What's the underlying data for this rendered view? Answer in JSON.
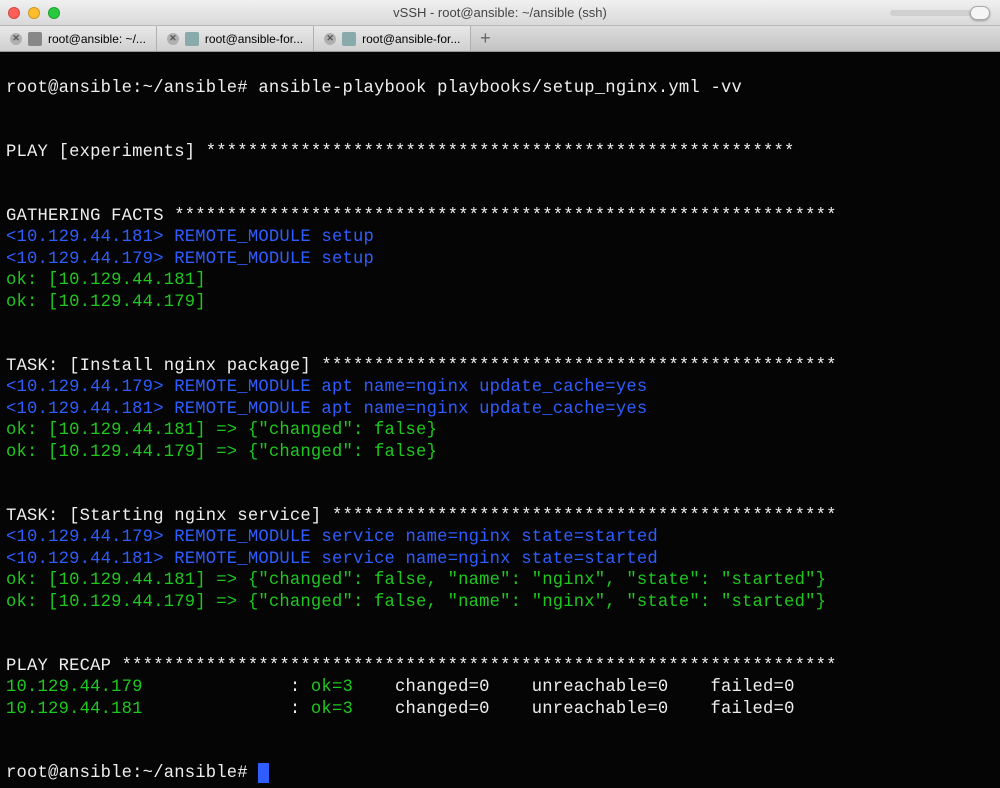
{
  "window": {
    "title": "vSSH - root@ansible: ~/ansible (ssh)"
  },
  "tabs": [
    {
      "label": "root@ansible: ~/...",
      "favicon_color": "grey"
    },
    {
      "label": "root@ansible-for...",
      "favicon_color": "greyblue"
    },
    {
      "label": "root@ansible-for...",
      "favicon_color": "greyblue"
    }
  ],
  "prompt1": "root@ansible:~/ansible# ",
  "command": "ansible-playbook playbooks/setup_nginx.yml -vv",
  "play_header": "PLAY [experiments] ******************************************************** ",
  "gather_header": "GATHERING FACTS *************************************************************** ",
  "remote_setup1": "<10.129.44.181> REMOTE_MODULE setup",
  "remote_setup2": "<10.129.44.179> REMOTE_MODULE setup",
  "ok_181": "ok: [10.129.44.181]",
  "ok_179": "ok: [10.129.44.179]",
  "task1_header": "TASK: [Install nginx package] ************************************************* ",
  "task1_remote1": "<10.129.44.179> REMOTE_MODULE apt name=nginx update_cache=yes",
  "task1_remote2": "<10.129.44.181> REMOTE_MODULE apt name=nginx update_cache=yes",
  "task1_ok1": "ok: [10.129.44.181] => {\"changed\": false}",
  "task1_ok2": "ok: [10.129.44.179] => {\"changed\": false}",
  "task2_header": "TASK: [Starting nginx service] ************************************************ ",
  "task2_remote1": "<10.129.44.179> REMOTE_MODULE service name=nginx state=started",
  "task2_remote2": "<10.129.44.181> REMOTE_MODULE service name=nginx state=started",
  "task2_ok1": "ok: [10.129.44.181] => {\"changed\": false, \"name\": \"nginx\", \"state\": \"started\"}",
  "task2_ok2": "ok: [10.129.44.179] => {\"changed\": false, \"name\": \"nginx\", \"state\": \"started\"}",
  "recap_header": "PLAY RECAP ******************************************************************** ",
  "recap1_host": "10.129.44.179              ",
  "recap1_colon": ": ",
  "recap1_ok": "ok=3   ",
  "recap1_rest": " changed=0    unreachable=0    failed=0   ",
  "recap2_host": "10.129.44.181              ",
  "recap2_colon": ": ",
  "recap2_ok": "ok=3   ",
  "recap2_rest": " changed=0    unreachable=0    failed=0   ",
  "prompt2": "root@ansible:~/ansible# "
}
